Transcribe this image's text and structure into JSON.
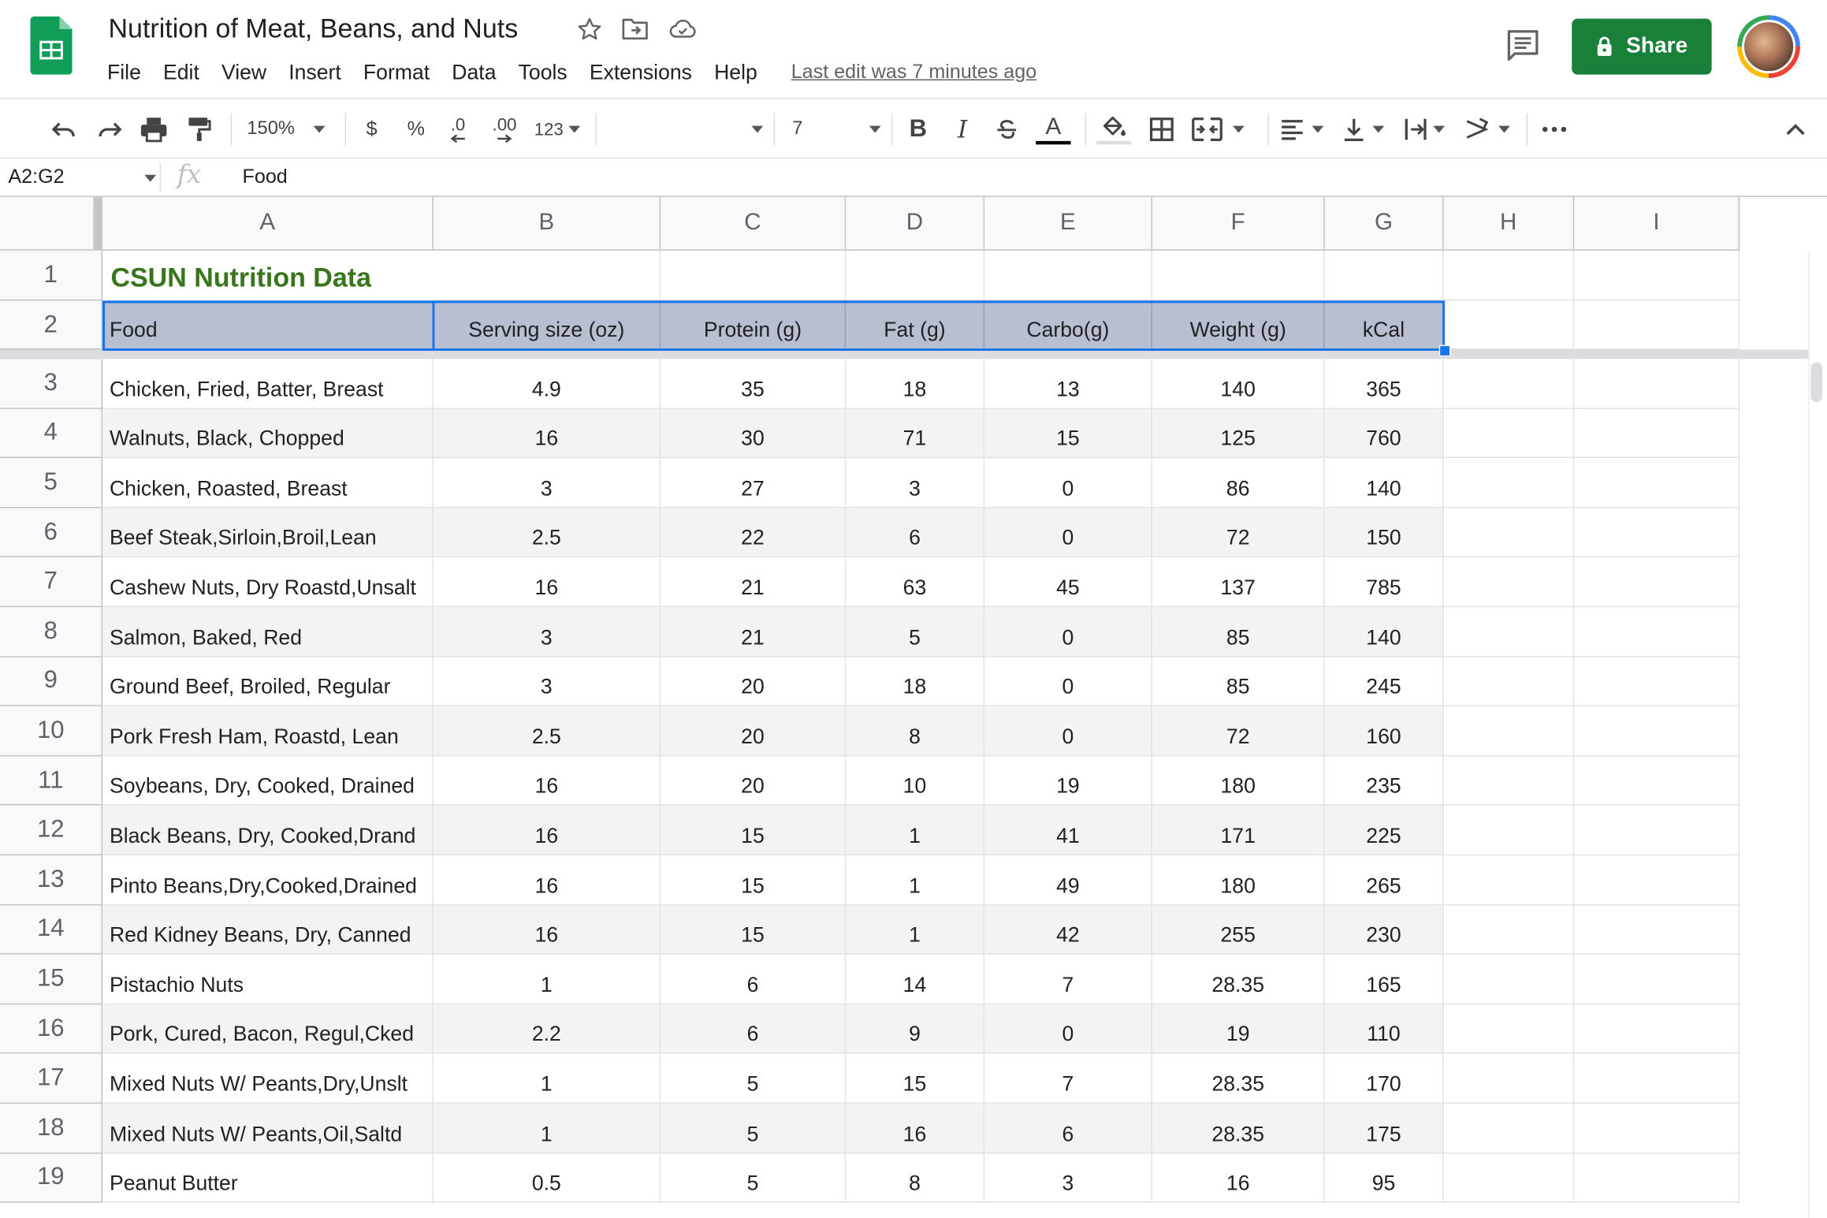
{
  "document": {
    "title": "Nutrition of Meat, Beans, and Nuts",
    "last_edit": "Last edit was 7 minutes ago"
  },
  "menu": [
    "File",
    "Edit",
    "View",
    "Insert",
    "Format",
    "Data",
    "Tools",
    "Extensions",
    "Help"
  ],
  "share": {
    "label": "Share"
  },
  "toolbar": {
    "zoom": "150%",
    "currency": "$",
    "percent": "%",
    "decimal_decrease": ".0",
    "decimal_increase": ".00",
    "number_format": "123",
    "font_size": "7",
    "bold": "B",
    "italic": "I",
    "text_color": "A"
  },
  "formula_bar": {
    "name_box": "A2:G2",
    "fx": "fx",
    "value": "Food"
  },
  "columns": [
    "A",
    "B",
    "C",
    "D",
    "E",
    "F",
    "G",
    "H",
    "I"
  ],
  "row_numbers": [
    "1",
    "2",
    "3",
    "4",
    "5",
    "6",
    "7",
    "8",
    "9",
    "10",
    "11",
    "12",
    "13",
    "14",
    "15",
    "16",
    "17",
    "18",
    "19"
  ],
  "sheet": {
    "title": "CSUN Nutrition Data",
    "headers": [
      "Food",
      "Serving size (oz)",
      "Protein (g)",
      "Fat (g)",
      "Carbo(g)",
      "Weight (g)",
      "kCal"
    ],
    "rows": [
      [
        "Chicken, Fried, Batter, Breast",
        "4.9",
        "35",
        "18",
        "13",
        "140",
        "365"
      ],
      [
        "Walnuts, Black, Chopped",
        "16",
        "30",
        "71",
        "15",
        "125",
        "760"
      ],
      [
        "Chicken, Roasted, Breast",
        "3",
        "27",
        "3",
        "0",
        "86",
        "140"
      ],
      [
        "Beef Steak,Sirloin,Broil,Lean",
        "2.5",
        "22",
        "6",
        "0",
        "72",
        "150"
      ],
      [
        "Cashew Nuts, Dry Roastd,Unsalt",
        "16",
        "21",
        "63",
        "45",
        "137",
        "785"
      ],
      [
        "Salmon, Baked, Red",
        "3",
        "21",
        "5",
        "0",
        "85",
        "140"
      ],
      [
        "Ground Beef, Broiled, Regular",
        "3",
        "20",
        "18",
        "0",
        "85",
        "245"
      ],
      [
        "Pork Fresh Ham, Roastd, Lean",
        "2.5",
        "20",
        "8",
        "0",
        "72",
        "160"
      ],
      [
        "Soybeans, Dry, Cooked, Drained",
        "16",
        "20",
        "10",
        "19",
        "180",
        "235"
      ],
      [
        "Black Beans, Dry, Cooked,Drand",
        "16",
        "15",
        "1",
        "41",
        "171",
        "225"
      ],
      [
        "Pinto Beans,Dry,Cooked,Drained",
        "16",
        "15",
        "1",
        "49",
        "180",
        "265"
      ],
      [
        "Red Kidney Beans, Dry, Canned",
        "16",
        "15",
        "1",
        "42",
        "255",
        "230"
      ],
      [
        "Pistachio Nuts",
        "1",
        "6",
        "14",
        "7",
        "28.35",
        "165"
      ],
      [
        "Pork, Cured, Bacon, Regul,Cked",
        "2.2",
        "6",
        "9",
        "0",
        "19",
        "110"
      ],
      [
        "Mixed Nuts W/ Peants,Dry,Unslt",
        "1",
        "5",
        "15",
        "7",
        "28.35",
        "170"
      ],
      [
        "Mixed Nuts W/ Peants,Oil,Saltd",
        "1",
        "5",
        "16",
        "6",
        "28.35",
        "175"
      ],
      [
        "Peanut Butter",
        "0.5",
        "5",
        "8",
        "3",
        "16",
        "95"
      ]
    ]
  },
  "colors": {
    "share_green": "#188038",
    "title_green": "#38761d",
    "header_fill": "#b7bfd0",
    "selection_blue": "#1a73e8",
    "alt_row": "#f3f3f3"
  }
}
